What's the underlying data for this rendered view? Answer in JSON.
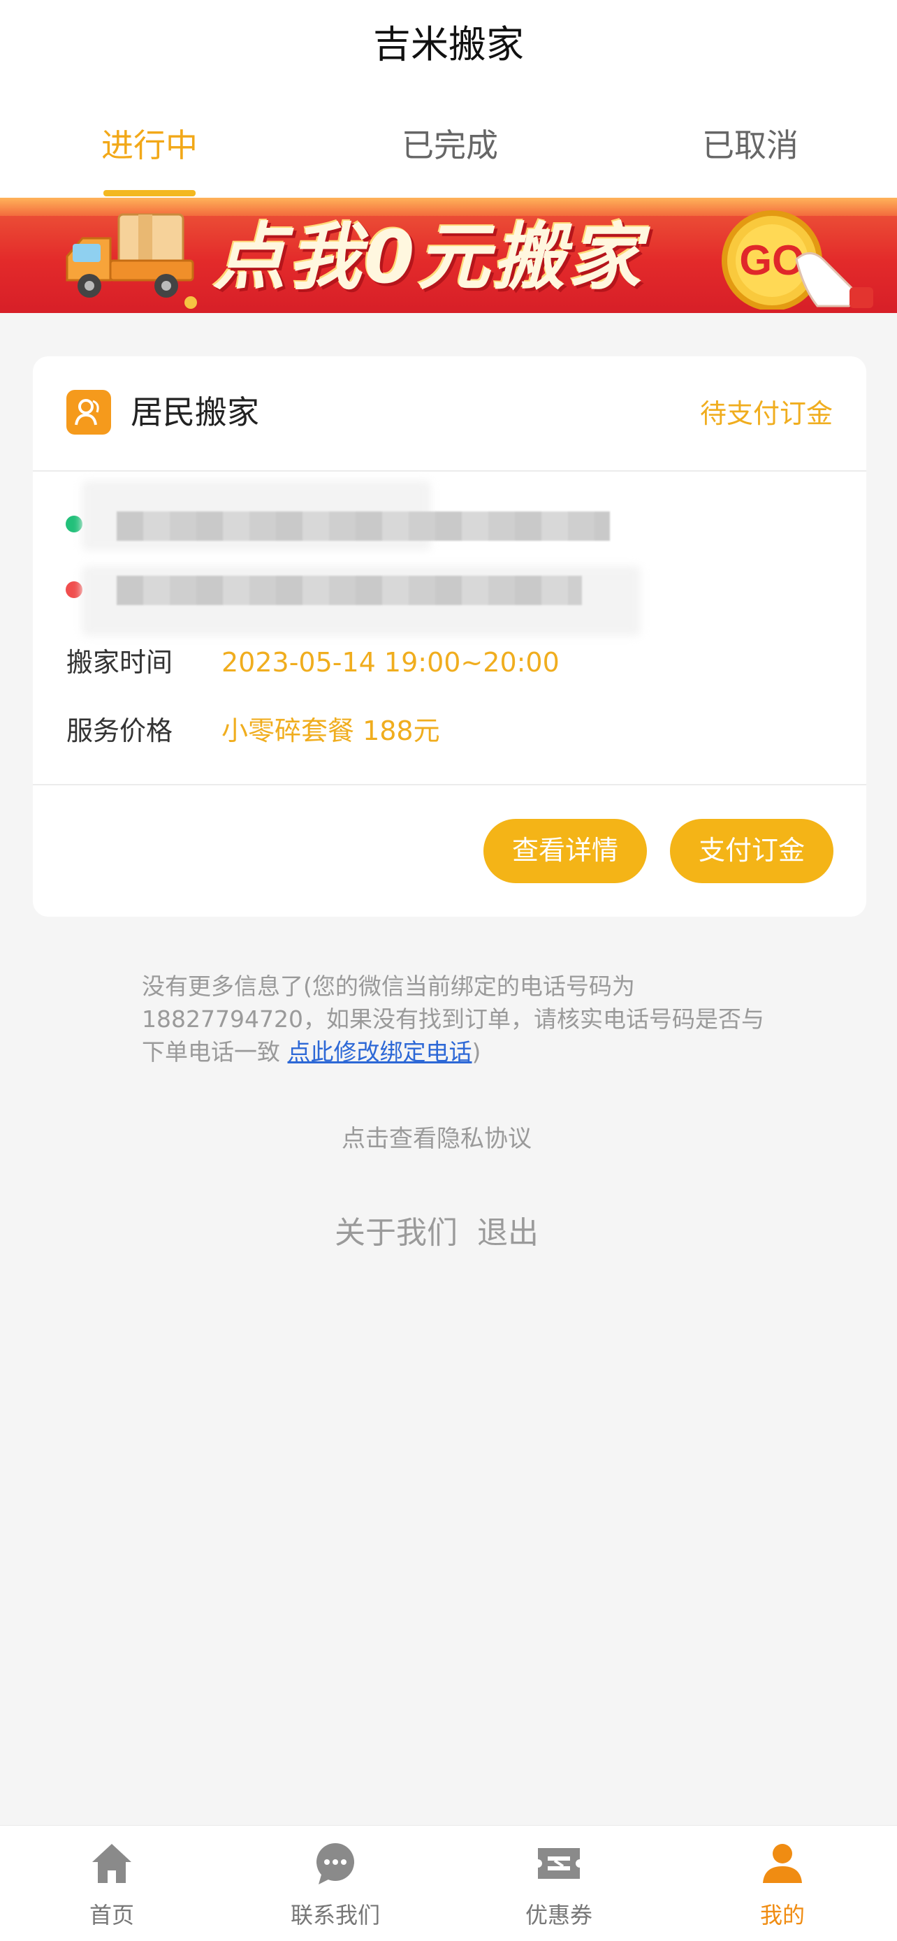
{
  "app": {
    "title": "吉米搬家"
  },
  "tabs": [
    {
      "label": "进行中",
      "active": true
    },
    {
      "label": "已完成",
      "active": false
    },
    {
      "label": "已取消",
      "active": false
    }
  ],
  "banner": {
    "text": "点我0元搬家",
    "go_label": "GO"
  },
  "order": {
    "type_label": "居民搬家",
    "status": "待支付订金",
    "time_label": "搬家时间",
    "time_value": "2023-05-14 19:00~20:00",
    "price_label": "服务价格",
    "price_value": "小零碎套餐 188元",
    "detail_button": "查看详情",
    "pay_button": "支付订金"
  },
  "notice": {
    "text": "没有更多信息了(您的微信当前绑定的电话号码为18827794720，如果没有找到订单，请核实电话号码是否与下单电话一致 ",
    "link": "点此修改绑定电话",
    "suffix": ")"
  },
  "footer": {
    "privacy": "点击查看隐私协议",
    "about": "关于我们",
    "logout": "退出"
  },
  "bottom_nav": [
    {
      "label": "首页",
      "icon": "home-icon",
      "active": false
    },
    {
      "label": "联系我们",
      "icon": "chat-icon",
      "active": false
    },
    {
      "label": "优惠券",
      "icon": "coupon-icon",
      "active": false
    },
    {
      "label": "我的",
      "icon": "user-icon",
      "active": true
    }
  ],
  "colors": {
    "accent": "#f4b417",
    "nav_active": "#f08c12",
    "start_dot": "#22c07a",
    "end_dot": "#f04e4e"
  }
}
